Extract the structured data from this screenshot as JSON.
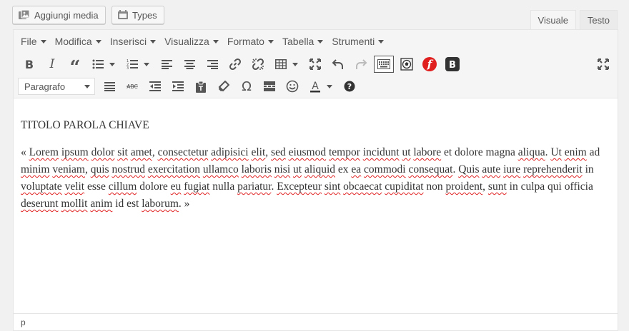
{
  "media_buttons": {
    "add_media": "Aggiungi media",
    "types": "Types"
  },
  "tabs": {
    "visual": "Visuale",
    "text": "Testo"
  },
  "menubar": {
    "file": "File",
    "edit": "Modifica",
    "insert": "Inserisci",
    "view": "Visualizza",
    "format": "Formato",
    "table": "Tabella",
    "tools": "Strumenti"
  },
  "toolbar": {
    "format_select": "Paragrafo",
    "icons": [
      "bold-icon",
      "italic-icon",
      "blockquote-icon",
      "bullet-list-icon",
      "numbered-list-icon",
      "align-left-icon",
      "align-center-icon",
      "align-right-icon",
      "link-icon",
      "unlink-icon",
      "table-icon",
      "fullscreen-icon",
      "undo-icon",
      "redo-icon",
      "toolbar-toggle-icon",
      "soccer-icon",
      "f-brand-icon",
      "b-brand-icon",
      "justify-icon",
      "strikethrough-icon",
      "outdent-icon",
      "indent-icon",
      "paste-text-icon",
      "clear-format-icon",
      "omega-icon",
      "read-more-icon",
      "emoji-icon",
      "text-color-icon",
      "help-icon"
    ],
    "accent_red": "#e01f1f",
    "accent_dark": "#333333"
  },
  "content": {
    "heading": "TITOLO PAROLA CHIAVE",
    "paragraph_segments": [
      {
        "t": "« ",
        "s": false
      },
      {
        "t": "Lorem",
        "s": true
      },
      {
        "t": " ",
        "s": false
      },
      {
        "t": "ipsum",
        "s": true
      },
      {
        "t": " ",
        "s": false
      },
      {
        "t": "dolor",
        "s": true
      },
      {
        "t": " ",
        "s": false
      },
      {
        "t": "sit",
        "s": true
      },
      {
        "t": " ",
        "s": false
      },
      {
        "t": "amet",
        "s": true
      },
      {
        "t": ", ",
        "s": false
      },
      {
        "t": "consectetur",
        "s": true
      },
      {
        "t": " ",
        "s": false
      },
      {
        "t": "adipisici",
        "s": true
      },
      {
        "t": " ",
        "s": false
      },
      {
        "t": "elit",
        "s": true
      },
      {
        "t": ", ",
        "s": false
      },
      {
        "t": "sed",
        "s": true
      },
      {
        "t": " ",
        "s": false
      },
      {
        "t": "eiusmod",
        "s": true
      },
      {
        "t": " ",
        "s": false
      },
      {
        "t": "tempor",
        "s": true
      },
      {
        "t": " ",
        "s": false
      },
      {
        "t": "incidunt",
        "s": true
      },
      {
        "t": " ",
        "s": false
      },
      {
        "t": "ut",
        "s": true
      },
      {
        "t": " ",
        "s": false
      },
      {
        "t": "labore",
        "s": true
      },
      {
        "t": " et dolore magna ",
        "s": false
      },
      {
        "t": "aliqua",
        "s": true
      },
      {
        "t": ". ",
        "s": false
      },
      {
        "t": "Ut",
        "s": true
      },
      {
        "t": " ",
        "s": false
      },
      {
        "t": "enim",
        "s": true
      },
      {
        "t": " ad ",
        "s": false
      },
      {
        "t": "minim",
        "s": true
      },
      {
        "t": " ",
        "s": false
      },
      {
        "t": "veniam",
        "s": true
      },
      {
        "t": ", ",
        "s": false
      },
      {
        "t": "quis",
        "s": true
      },
      {
        "t": " ",
        "s": false
      },
      {
        "t": "nostrud",
        "s": true
      },
      {
        "t": " ",
        "s": false
      },
      {
        "t": "exercitation",
        "s": true
      },
      {
        "t": " ",
        "s": false
      },
      {
        "t": "ullamco",
        "s": true
      },
      {
        "t": " ",
        "s": false
      },
      {
        "t": "laboris",
        "s": true
      },
      {
        "t": " ",
        "s": false
      },
      {
        "t": "nisi",
        "s": true
      },
      {
        "t": " ",
        "s": false
      },
      {
        "t": "ut",
        "s": true
      },
      {
        "t": " ",
        "s": false
      },
      {
        "t": "aliquid",
        "s": true
      },
      {
        "t": " ex ",
        "s": false
      },
      {
        "t": "ea",
        "s": true
      },
      {
        "t": " ",
        "s": false
      },
      {
        "t": "commodi",
        "s": true
      },
      {
        "t": " ",
        "s": false
      },
      {
        "t": "consequat",
        "s": true
      },
      {
        "t": ". ",
        "s": false
      },
      {
        "t": "Quis",
        "s": true
      },
      {
        "t": " ",
        "s": false
      },
      {
        "t": "aute",
        "s": true
      },
      {
        "t": " ",
        "s": false
      },
      {
        "t": "iure",
        "s": true
      },
      {
        "t": " ",
        "s": false
      },
      {
        "t": "reprehenderit",
        "s": true
      },
      {
        "t": " in ",
        "s": false
      },
      {
        "t": "voluptate",
        "s": true
      },
      {
        "t": " ",
        "s": false
      },
      {
        "t": "velit",
        "s": true
      },
      {
        "t": " esse ",
        "s": false
      },
      {
        "t": "cillum",
        "s": true
      },
      {
        "t": " dolore ",
        "s": false
      },
      {
        "t": "eu",
        "s": true
      },
      {
        "t": " ",
        "s": false
      },
      {
        "t": "fugiat",
        "s": true
      },
      {
        "t": " nulla ",
        "s": false
      },
      {
        "t": "pariatur",
        "s": true
      },
      {
        "t": ". ",
        "s": false
      },
      {
        "t": "Excepteur",
        "s": true
      },
      {
        "t": " ",
        "s": false
      },
      {
        "t": "sint",
        "s": true
      },
      {
        "t": " ",
        "s": false
      },
      {
        "t": "obcaecat",
        "s": true
      },
      {
        "t": " ",
        "s": false
      },
      {
        "t": "cupiditat",
        "s": true
      },
      {
        "t": " non ",
        "s": false
      },
      {
        "t": "proident",
        "s": true
      },
      {
        "t": ", ",
        "s": false
      },
      {
        "t": "sunt",
        "s": true
      },
      {
        "t": " in culpa qui officia ",
        "s": false
      },
      {
        "t": "deserunt",
        "s": true
      },
      {
        "t": " ",
        "s": false
      },
      {
        "t": "mollit",
        "s": true
      },
      {
        "t": " ",
        "s": false
      },
      {
        "t": "anim",
        "s": true
      },
      {
        "t": " id est ",
        "s": false
      },
      {
        "t": "laborum",
        "s": true
      },
      {
        "t": ". »",
        "s": false
      }
    ]
  },
  "statusbar": {
    "path": "p"
  }
}
